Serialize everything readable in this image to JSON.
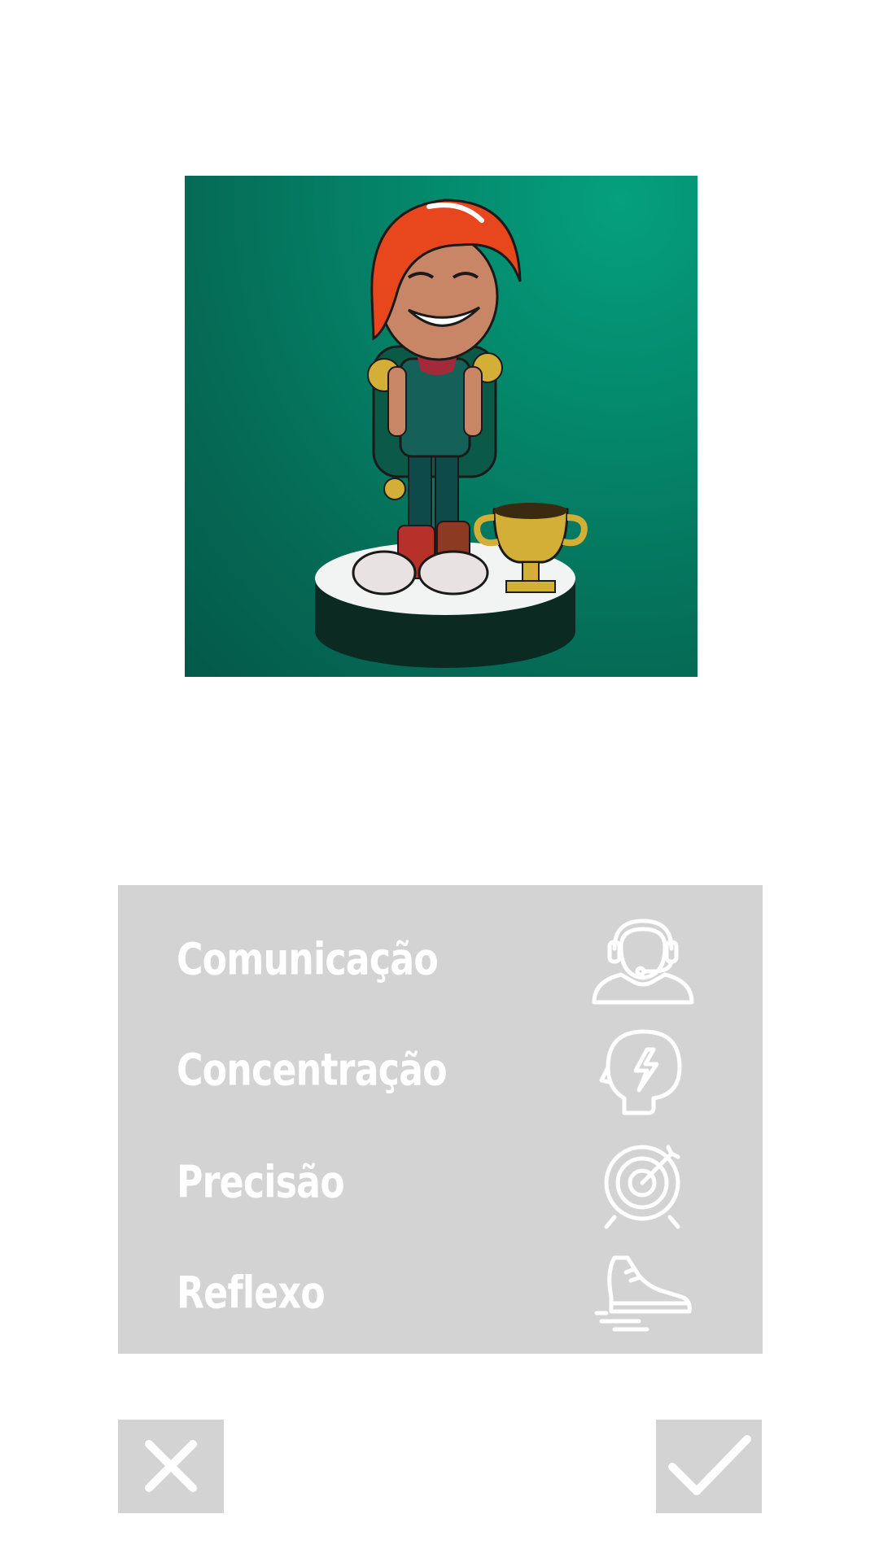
{
  "hero": {
    "icon": "character-avatar-with-trophy",
    "background_color": "#04866a"
  },
  "skills": [
    {
      "label": "Comunicação",
      "icon": "headset-person-icon"
    },
    {
      "label": "Concentração",
      "icon": "head-lightning-icon"
    },
    {
      "label": "Precisão",
      "icon": "target-icon"
    },
    {
      "label": "Reflexo",
      "icon": "running-shoe-icon"
    }
  ],
  "actions": {
    "cancel_icon": "close-icon",
    "confirm_icon": "checkmark-icon"
  },
  "colors": {
    "panel": "#d3d3d3",
    "text": "#ffffff",
    "background": "#ffffff"
  }
}
